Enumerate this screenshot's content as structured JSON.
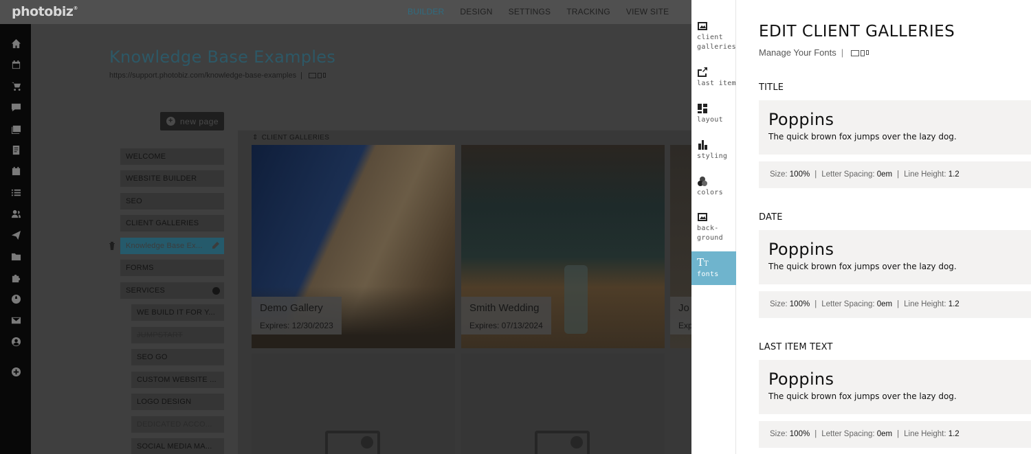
{
  "app": {
    "logo": "photobiz",
    "logo_mark": "®"
  },
  "topnav": {
    "items": [
      {
        "label": "BUILDER",
        "active": true
      },
      {
        "label": "DESIGN",
        "active": false
      },
      {
        "label": "SETTINGS",
        "active": false
      },
      {
        "label": "TRACKING",
        "active": false
      },
      {
        "label": "VIEW SITE",
        "active": false
      }
    ]
  },
  "rail": {
    "icons": [
      "home-icon",
      "calendar-icon",
      "cart-icon",
      "chat-icon",
      "gallery-icon",
      "document-icon",
      "event-icon",
      "list-icon",
      "contacts-icon",
      "send-icon",
      "folder-icon",
      "puzzle-icon",
      "globe-icon",
      "mail-icon",
      "account-icon",
      "add-icon"
    ]
  },
  "page": {
    "title": "Knowledge Base Examples",
    "url": "https://support.photobiz.com/knowledge-base-examples",
    "url_sep": "|"
  },
  "new_page": {
    "label": "new page"
  },
  "pages": {
    "welcome": "WELCOME",
    "website_builder": "WEBSITE BUILDER",
    "seo": "SEO",
    "client_galleries": "CLIENT GALLERIES",
    "kb": "Knowledge Base Ex...",
    "forms": "FORMS",
    "services": "SERVICES",
    "sub": {
      "we_build": "WE BUILD IT FOR Y...",
      "jumpstart": "JUMPSTART",
      "seo_go": "SEO GO",
      "custom_website": "CUSTOM WEBSITE ...",
      "logo_design": "LOGO DESIGN",
      "dedicated": "DEDICATED ACCO...",
      "social_media": "SOCIAL MEDIA MA..."
    }
  },
  "gallery_section": {
    "label": "CLIENT GALLERIES",
    "cards": [
      {
        "name": "Demo Gallery",
        "expires": "Expires: 12/30/2023"
      },
      {
        "name": "Smith Wedding",
        "expires": "Expires: 07/13/2024"
      },
      {
        "name": "Jo",
        "expires": "Exp"
      }
    ]
  },
  "tabs": {
    "client_galleries": "client\ngalleries",
    "last_item": "last item",
    "layout": "layout",
    "styling": "styling",
    "colors": "colors",
    "background": "back-\nground",
    "fonts": "fonts"
  },
  "panel": {
    "title": "EDIT CLIENT GALLERIES",
    "subtitle": "Manage Your Fonts",
    "subtitle_sep": "|",
    "sections": [
      {
        "heading": "TITLE",
        "font": "Poppins",
        "sample": "The quick brown fox jumps over the lazy dog.",
        "size_label": "Size:",
        "size": "100%",
        "spacing_label": "Letter Spacing:",
        "spacing": "0em",
        "lh_label": "Line Height:",
        "lh": "1.2",
        "sep": "|"
      },
      {
        "heading": "DATE",
        "font": "Poppins",
        "sample": "The quick brown fox jumps over the lazy dog.",
        "size_label": "Size:",
        "size": "100%",
        "spacing_label": "Letter Spacing:",
        "spacing": "0em",
        "lh_label": "Line Height:",
        "lh": "1.2",
        "sep": "|"
      },
      {
        "heading": "LAST ITEM TEXT",
        "font": "Poppins",
        "sample": "The quick brown fox jumps over the lazy dog.",
        "size_label": "Size:",
        "size": "100%",
        "spacing_label": "Letter Spacing:",
        "spacing": "0em",
        "lh_label": "Line Height:",
        "lh": "1.2",
        "sep": "|"
      }
    ]
  },
  "colors": {
    "accent": "#6fb4cd",
    "active_page": "#255a6b",
    "rail_bg": "#080808"
  }
}
